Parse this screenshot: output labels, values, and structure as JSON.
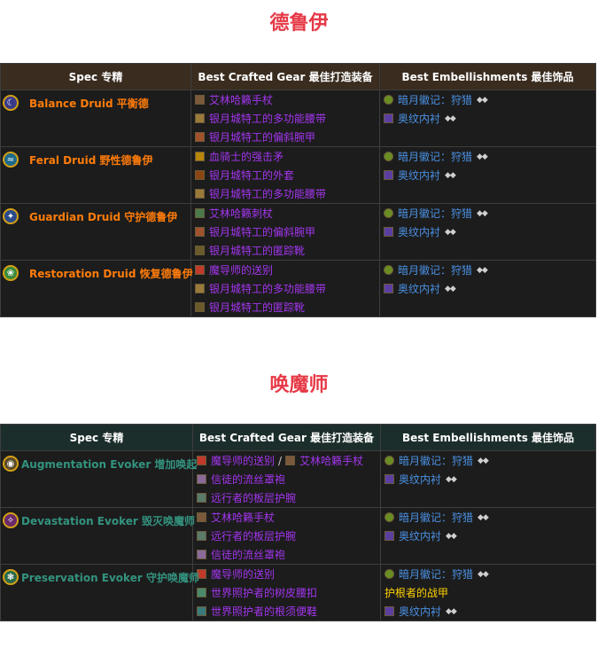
{
  "druid": {
    "title": "德鲁伊",
    "headers": [
      "Spec 专精",
      "Best Crafted Gear 最佳打造装备",
      "Best Embellishments 最佳饰品"
    ],
    "rows": [
      {
        "spec": "Balance Druid 平衡德",
        "icon": "balance-druid-icon",
        "gear": [
          {
            "text": "艾林哈籁手杖",
            "icon": "staff-icon"
          },
          {
            "text": "银月城特工的多功能腰带",
            "icon": "belt-icon"
          },
          {
            "text": "银月城特工的偏斜腕甲",
            "icon": "bracers-icon"
          }
        ],
        "emb": [
          {
            "text": "暗月徽记：狩猎",
            "icon": "darkmoon-sigil-icon",
            "pips": "◆◆"
          },
          {
            "text": "奥纹内衬",
            "icon": "arcanoweave-lining-icon",
            "pips": "◆◆"
          }
        ]
      },
      {
        "spec": "Feral Druid 野性德鲁伊",
        "icon": "feral-druid-icon",
        "gear": [
          {
            "text": "血骑士的强击矛",
            "icon": "polearm-icon"
          },
          {
            "text": "银月城特工的外套",
            "icon": "chest-icon"
          },
          {
            "text": "银月城特工的多功能腰带",
            "icon": "belt-icon"
          }
        ],
        "emb": [
          {
            "text": "暗月徽记：狩猎",
            "icon": "darkmoon-sigil-icon",
            "pips": "◆◆"
          },
          {
            "text": "奥纹内衬",
            "icon": "arcanoweave-lining-icon",
            "pips": "◆◆"
          }
        ]
      },
      {
        "spec": "Guardian Druid 守护德鲁伊",
        "icon": "guardian-druid-icon",
        "gear": [
          {
            "text": "艾林哈籁刺杖",
            "icon": "staff-icon"
          },
          {
            "text": "银月城特工的偏斜腕甲",
            "icon": "bracers-icon"
          },
          {
            "text": "银月城特工的匿踪靴",
            "icon": "boots-icon"
          }
        ],
        "emb": [
          {
            "text": "暗月徽记：狩猎",
            "icon": "darkmoon-sigil-icon",
            "pips": "◆◆"
          },
          {
            "text": "奥纹内衬",
            "icon": "arcanoweave-lining-icon",
            "pips": "◆◆"
          }
        ]
      },
      {
        "spec": "Restoration Druid 恢复德鲁伊",
        "icon": "restoration-druid-icon",
        "gear": [
          {
            "text": "魔导师的送别",
            "icon": "wand-icon"
          },
          {
            "text": "银月城特工的多功能腰带",
            "icon": "belt-icon"
          },
          {
            "text": "银月城特工的匿踪靴",
            "icon": "boots-icon"
          }
        ],
        "emb": [
          {
            "text": "暗月徽记：狩猎",
            "icon": "darkmoon-sigil-icon",
            "pips": "◆◆"
          },
          {
            "text": "奥纹内衬",
            "icon": "arcanoweave-lining-icon",
            "pips": "◆◆"
          }
        ]
      }
    ]
  },
  "evoker": {
    "title": "唤魔师",
    "headers": [
      "Spec 专精",
      "Best Crafted Gear 最佳打造装备",
      "Best Embellishments 最佳饰品"
    ],
    "rows": [
      {
        "spec": "Augmentation Evoker 增加唤起",
        "icon": "augmentation-evoker-icon",
        "gear_first_a": "魔导师的送别",
        "gear_first_sep": "/",
        "gear_first_b": "艾林哈籁手杖",
        "gear": [
          {
            "text": "信徒的流丝罩袍",
            "icon": "robe-icon"
          },
          {
            "text": "远行者的板层护腕",
            "icon": "bracers-icon"
          }
        ],
        "emb": [
          {
            "text": "暗月徽记：狩猎",
            "icon": "darkmoon-sigil-icon",
            "pips": "◆◆"
          },
          {
            "text": "奥纹内衬",
            "icon": "arcanoweave-lining-icon",
            "pips": "◆◆"
          }
        ]
      },
      {
        "spec": "Devastation Evoker 毁灭唤魔师",
        "icon": "devastation-evoker-icon",
        "gear": [
          {
            "text": "艾林哈籁手杖",
            "icon": "staff-icon"
          },
          {
            "text": "远行者的板层护腕",
            "icon": "bracers-icon"
          },
          {
            "text": "信徒的流丝罩袍",
            "icon": "robe-icon"
          }
        ],
        "emb": [
          {
            "text": "暗月徽记：狩猎",
            "icon": "darkmoon-sigil-icon",
            "pips": "◆◆"
          },
          {
            "text": "奥纹内衬",
            "icon": "arcanoweave-lining-icon",
            "pips": "◆◆"
          }
        ]
      },
      {
        "spec": "Preservation Evoker 守护唤魔师",
        "icon": "preservation-evoker-icon",
        "gear": [
          {
            "text": "魔导师的送别",
            "icon": "wand-icon"
          },
          {
            "text": "世界照护者的树皮腰扣",
            "icon": "belt-icon"
          },
          {
            "text": "世界照护者的根须便鞋",
            "icon": "boots-icon"
          }
        ],
        "emb_sigil": {
          "text": "暗月徽记：狩猎",
          "icon": "darkmoon-sigil-icon",
          "pips": "◆◆"
        },
        "emb_gold": "护根者的战甲",
        "emb_lining": {
          "text": "奥纹内衬",
          "icon": "arcanoweave-lining-icon",
          "pips": "◆◆"
        }
      }
    ]
  },
  "colors": {
    "title_red": "#e63946",
    "druid_orange": "#ff7c0a",
    "evoker_teal": "#33937f",
    "epic_purple": "#a335ee",
    "rare_blue": "#4a90e2",
    "legendary_gold": "#ffd100"
  }
}
